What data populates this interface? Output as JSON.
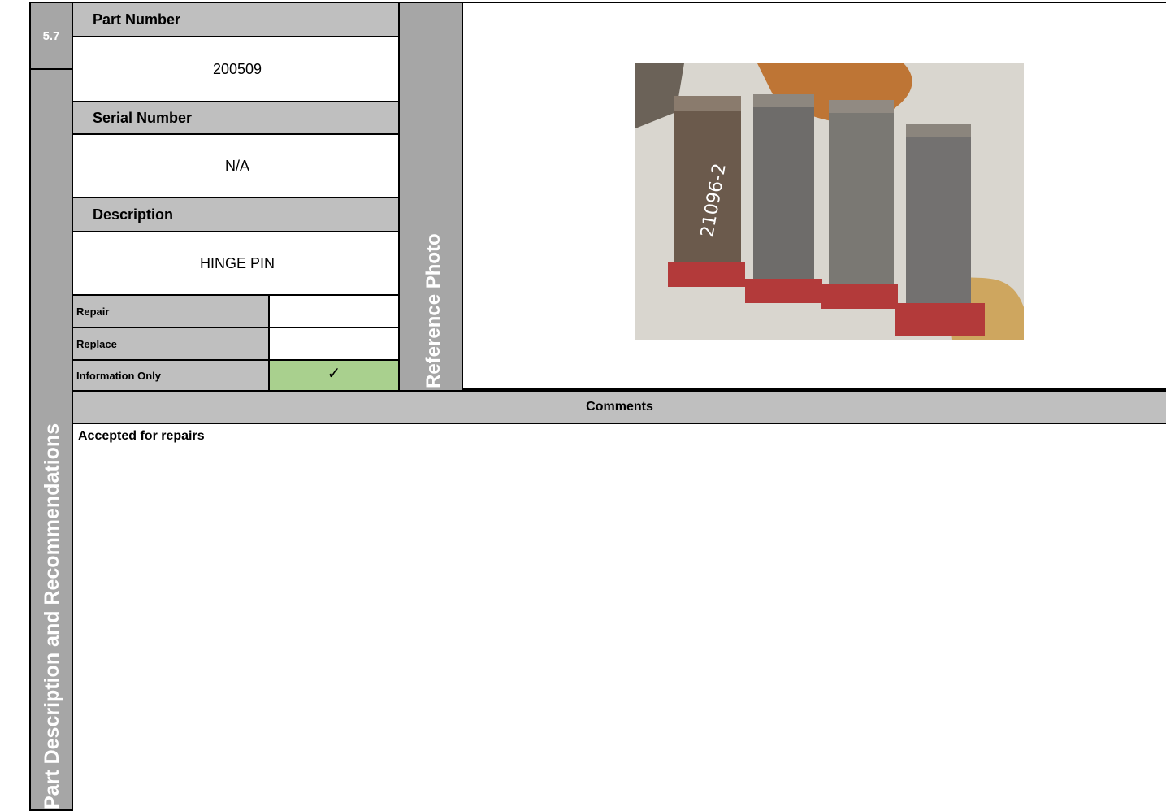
{
  "section": {
    "number": "5.7",
    "side_title": "Part Description and Recommendations"
  },
  "part_number": {
    "label": "Part Number",
    "value": "200509"
  },
  "serial_number": {
    "label": "Serial Number",
    "value": "N/A"
  },
  "description": {
    "label": "Description",
    "value": "HINGE PIN"
  },
  "options": [
    {
      "label": "Repair",
      "checked": false,
      "mark": ""
    },
    {
      "label": "Replace",
      "checked": false,
      "mark": ""
    },
    {
      "label": "Information Only",
      "checked": true,
      "mark": "✓"
    }
  ],
  "photo": {
    "side_label": "Reference Photo",
    "content": "four hinge pins",
    "handwritten_marking": "21096-2"
  },
  "comments": {
    "header": "Comments",
    "text": "Accepted for repairs"
  },
  "colors": {
    "header_gray": "#a6a6a6",
    "check_green": "#a9d08e",
    "rust": "#c0701f",
    "red_base": "#b33a3a"
  }
}
